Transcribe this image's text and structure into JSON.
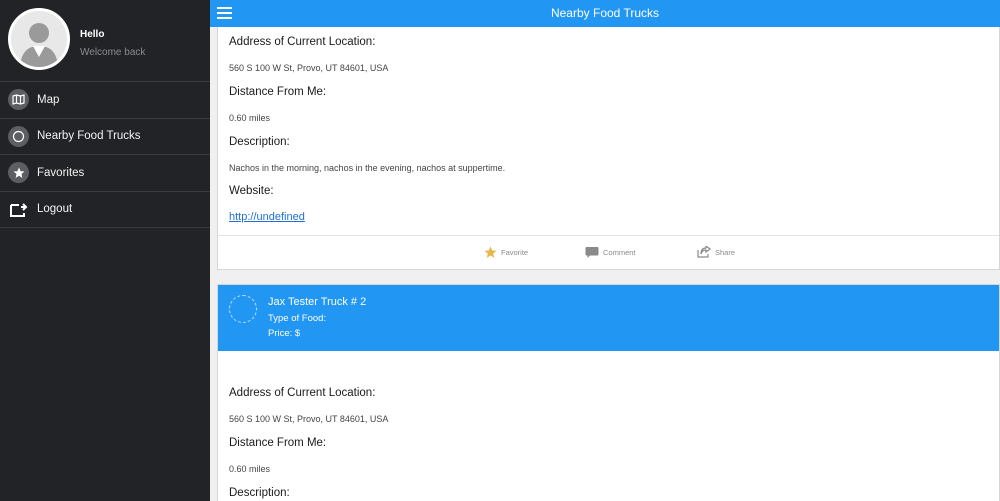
{
  "header": {
    "title": "Nearby Food Trucks",
    "menu_icon": "hamburger-icon"
  },
  "sidebar": {
    "greeting": "Hello",
    "subgreeting": "Welcome back",
    "items": [
      {
        "label": "Map",
        "icon": "map-icon"
      },
      {
        "label": "Nearby Food Trucks",
        "icon": "compass-icon"
      },
      {
        "label": "Favorites",
        "icon": "star-icon"
      },
      {
        "label": "Logout",
        "icon": "logout-icon"
      }
    ]
  },
  "card1": {
    "address_label": "Address of Current Location:",
    "address": "560 S 100 W St, Provo, UT 84601, USA",
    "distance_label": "Distance From Me:",
    "distance": "0.60 miles",
    "description_label": "Description:",
    "description": "Nachos in the morning, nachos in the evening, nachos at suppertime.",
    "website_label": "Website:",
    "website": "http://undefined",
    "actions": {
      "favorite": "Favorite",
      "comment": "Comment",
      "share": "Share"
    }
  },
  "card2": {
    "name": "Jax Tester Truck # 2",
    "type_of_food": "Type of Food:",
    "price": "Price: $",
    "address_label": "Address of Current Location:",
    "address": "560 S 100 W St, Provo, UT 84601, USA",
    "distance_label": "Distance From Me:",
    "distance": "0.60 miles",
    "description_label": "Description:"
  },
  "colors": {
    "accent": "#2196f3",
    "sidebar": "#222327",
    "star": "#e8b64a",
    "link": "#1e6fd8"
  }
}
